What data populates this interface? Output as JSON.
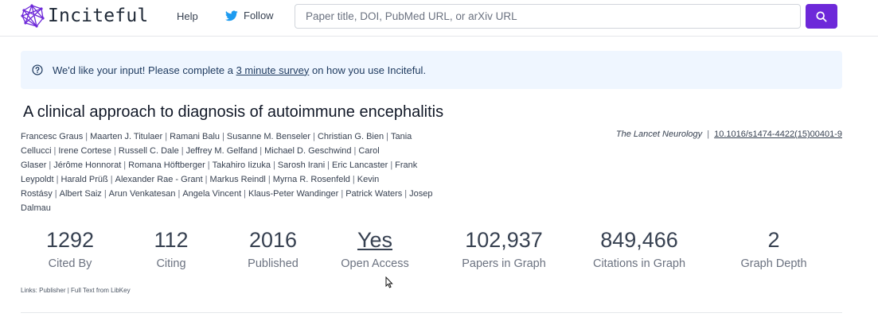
{
  "navbar": {
    "brand_name": "Inciteful",
    "help_label": "Help",
    "follow_label": "Follow",
    "search": {
      "placeholder": "Paper title, DOI, PubMed URL, or arXiv URL",
      "value": ""
    }
  },
  "banner": {
    "text_before": "We'd like your input! Please complete a ",
    "link_text": "3 minute survey",
    "text_after": " on how you use Inciteful."
  },
  "paper": {
    "title": "A clinical approach to diagnosis of autoimmune encephalitis",
    "authors": [
      "Francesc Graus",
      "Maarten J. Titulaer",
      "Ramani Balu",
      "Susanne M. Benseler",
      "Christian G. Bien",
      "Tania Cellucci",
      "Irene Cortese",
      "Russell C. Dale",
      "Jeffrey M. Gelfand",
      "Michael D. Geschwind",
      "Carol Glaser",
      "Jérôme Honnorat",
      "Romana Höftberger",
      "Takahiro Iizuka",
      "Sarosh Irani",
      "Eric Lancaster",
      "Frank Leypoldt",
      "Harald Prüß",
      "Alexander Rae - Grant",
      "Markus Reindl",
      "Myrna R. Rosenfeld",
      "Kevin Rostásy",
      "Albert Saiz",
      "Arun Venkatesan",
      "Angela Vincent",
      "Klaus-Peter Wandinger",
      "Patrick Waters",
      "Josep Dalmau"
    ],
    "journal": "The Lancet Neurology",
    "doi": "10.1016/s1474-4422(15)00401-9"
  },
  "stats": [
    {
      "value": "1292",
      "label": "Cited By"
    },
    {
      "value": "112",
      "label": "Citing"
    },
    {
      "value": "2016",
      "label": "Published"
    },
    {
      "value": "Yes",
      "label": "Open Access"
    },
    {
      "value": "102,937",
      "label": "Papers in Graph"
    },
    {
      "value": "849,466",
      "label": "Citations in Graph"
    },
    {
      "value": "2",
      "label": "Graph Depth"
    }
  ],
  "links": {
    "prefix": "Links: ",
    "publisher": "Publisher",
    "separator": " | ",
    "fulltext": "Full Text from LibKey"
  },
  "colors": {
    "accent": "#6d28d9",
    "banner_bg": "#eff6ff",
    "twitter": "#1d9bf0"
  }
}
